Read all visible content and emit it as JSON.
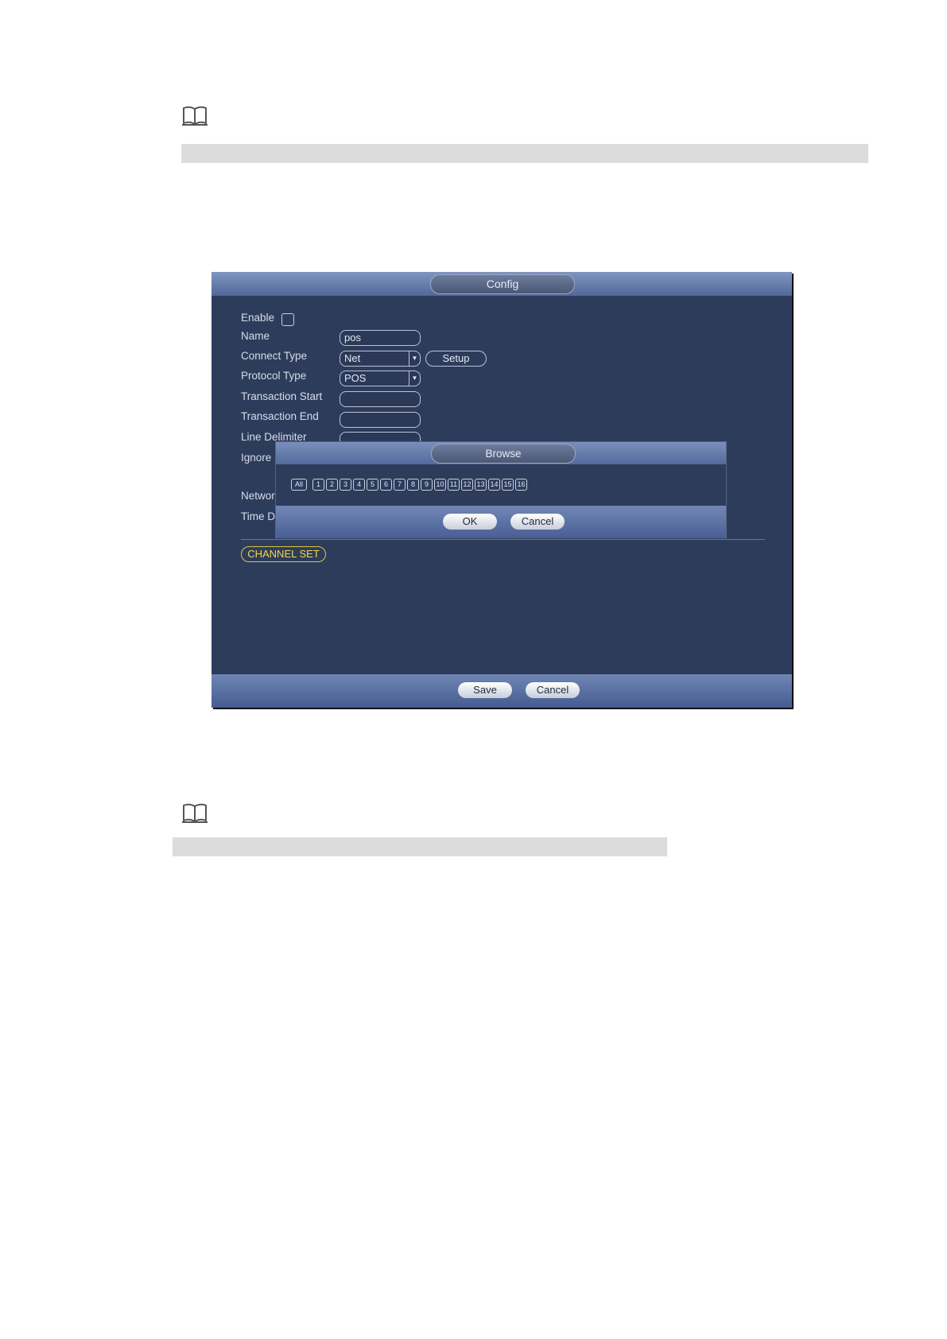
{
  "config": {
    "title": "Config",
    "enable_label": "Enable",
    "name_label": "Name",
    "name_value": "pos",
    "connect_type_label": "Connect Type",
    "connect_type_value": "Net",
    "setup_label": "Setup",
    "protocol_type_label": "Protocol Type",
    "protocol_type_value": "POS",
    "transaction_start_label": "Transaction Start",
    "transaction_end_label": "Transaction End",
    "line_delimiter_label": "Line Delimiter",
    "ignore_label": "Ignore",
    "network_label": "Networ",
    "time_label": "Time D",
    "channel_set_label": "CHANNEL SET",
    "save_label": "Save",
    "cancel_label": "Cancel"
  },
  "browse": {
    "title": "Browse",
    "all_label": "All",
    "channels": [
      "1",
      "2",
      "3",
      "4",
      "5",
      "6",
      "7",
      "8",
      "9",
      "10",
      "11",
      "12",
      "13",
      "14",
      "15",
      "16"
    ],
    "ok_label": "OK",
    "cancel_label": "Cancel"
  },
  "icons": {
    "note": "book-icon"
  }
}
